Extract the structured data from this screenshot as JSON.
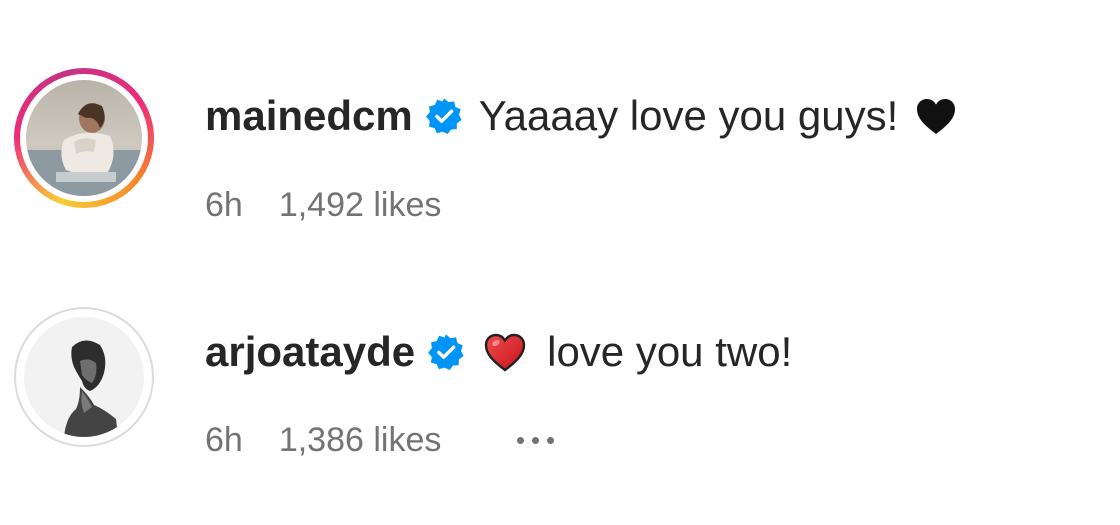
{
  "comments": [
    {
      "username": "mainedcm",
      "verified": true,
      "text": "Yaaaay love you guys!",
      "emoji": "black-heart",
      "time": "6h",
      "likes": "1,492 likes",
      "has_story_ring": true
    },
    {
      "username": "arjoatayde",
      "verified": true,
      "text": "love you two!",
      "emoji": "red-heart",
      "time": "6h",
      "likes": "1,386 likes",
      "has_story_ring": false,
      "more_options": "•••"
    }
  ],
  "colors": {
    "verified_badge": "#0095f6",
    "text_primary": "#262626",
    "text_secondary": "#737373",
    "red_heart": "#e0242b"
  }
}
